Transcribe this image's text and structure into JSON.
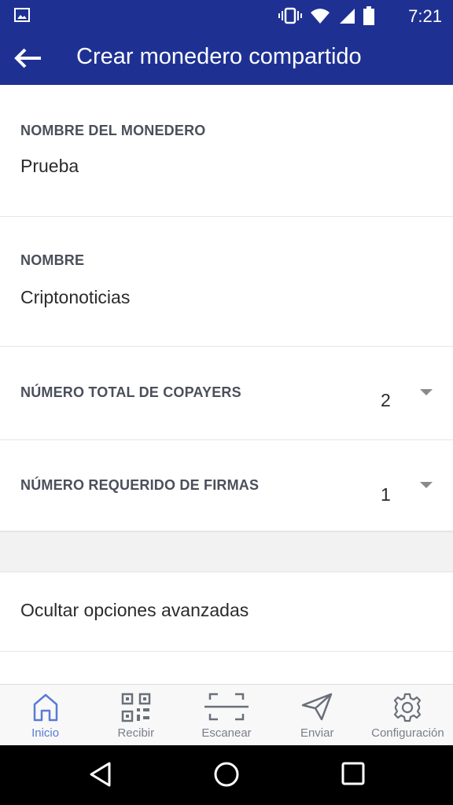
{
  "status_bar": {
    "time": "7:21"
  },
  "app_bar": {
    "title": "Crear monedero compartido"
  },
  "form": {
    "wallet_name": {
      "label": "NOMBRE DEL MONEDERO",
      "value": "Prueba"
    },
    "name": {
      "label": "NOMBRE",
      "value": "Criptonoticias"
    },
    "total_copayers": {
      "label": "NÚMERO TOTAL DE COPAYERS",
      "value": "2"
    },
    "required_signatures": {
      "label": "NÚMERO REQUERIDO DE FIRMAS",
      "value": "1"
    },
    "advanced_toggle": "Ocultar opciones avanzadas"
  },
  "tabs": [
    {
      "label": "Inicio",
      "icon": "home-icon",
      "active": true
    },
    {
      "label": "Recibir",
      "icon": "qr-code-icon",
      "active": false
    },
    {
      "label": "Escanear",
      "icon": "scan-icon",
      "active": false
    },
    {
      "label": "Enviar",
      "icon": "send-icon",
      "active": false
    },
    {
      "label": "Configuración",
      "icon": "settings-icon",
      "active": false
    }
  ],
  "colors": {
    "primary": "#1e3193",
    "active_tab": "#5b7bd3",
    "inactive_tab": "#7a7f88"
  }
}
